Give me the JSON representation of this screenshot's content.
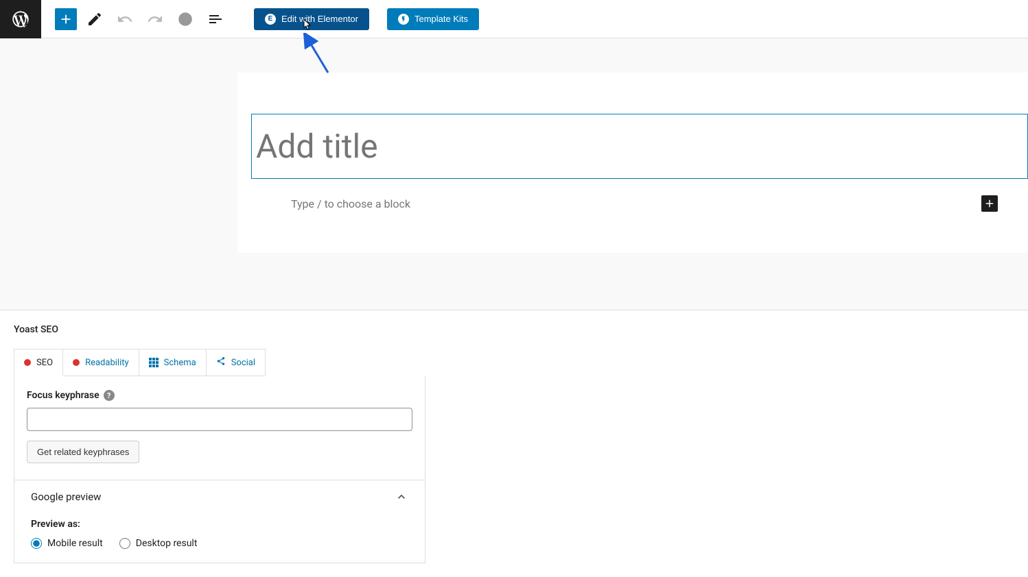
{
  "toolbar": {
    "elementor_label": "Edit with Elementor",
    "template_kits_label": "Template Kits"
  },
  "editor": {
    "title_placeholder": "Add title",
    "block_prompt": "Type / to choose a block"
  },
  "yoast": {
    "section_title": "Yoast SEO",
    "tabs": {
      "seo": "SEO",
      "readability": "Readability",
      "schema": "Schema",
      "social": "Social"
    },
    "focus_keyphrase_label": "Focus keyphrase",
    "related_btn": "Get related keyphrases",
    "google_preview_title": "Google preview",
    "preview_as_label": "Preview as:",
    "mobile_result": "Mobile result",
    "desktop_result": "Desktop result"
  }
}
